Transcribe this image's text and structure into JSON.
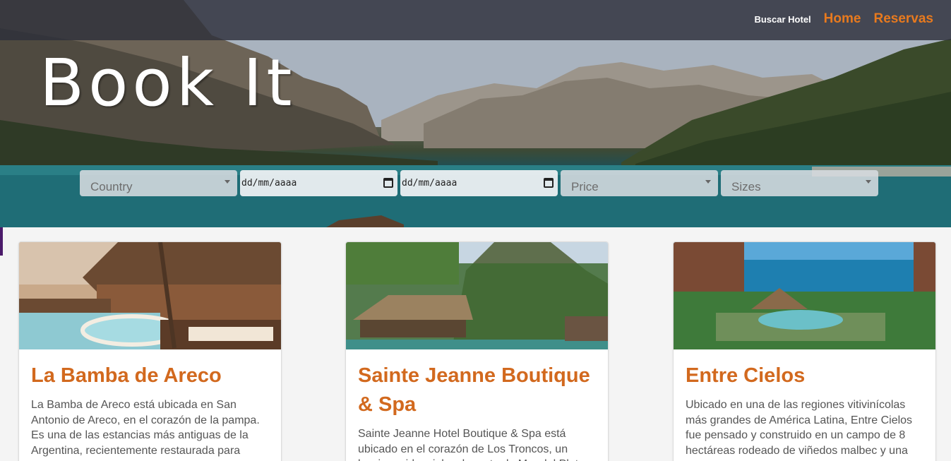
{
  "nav": {
    "search_hotel": "Buscar Hotel",
    "home": "Home",
    "reservations": "Reservas"
  },
  "brand": {
    "logo": "Book It"
  },
  "filters": {
    "country_placeholder": "Country",
    "checkin_value": "dd/mm/aaaa",
    "checkout_value": "dd/mm/aaaa",
    "price_placeholder": "Price",
    "sizes_placeholder": "Sizes"
  },
  "hotels": [
    {
      "name": "La Bamba de Areco",
      "description": "La Bamba de Areco está ubicada en San Antonio de Areco, en el corazón de la pampa. Es una de las estancias más antiguas de la Argentina, recientemente restaurada para"
    },
    {
      "name": "Sainte Jeanne Boutique & Spa",
      "description": "Sainte Jeanne Hotel Boutique & Spa está ubicado en el corazón de Los Troncos, un barrio residencial y elegante de Mar del Plata"
    },
    {
      "name": "Entre Cielos",
      "description": "Ubicado en una de las regiones vitivinícolas más grandes de América Latina, Entre Cielos fue pensado y construido en un campo de 8 hectáreas rodeado de viñedos malbec y una"
    }
  ],
  "colors": {
    "accent": "#e87a1e",
    "title": "#d2691e",
    "topbar": "#2d303a"
  }
}
